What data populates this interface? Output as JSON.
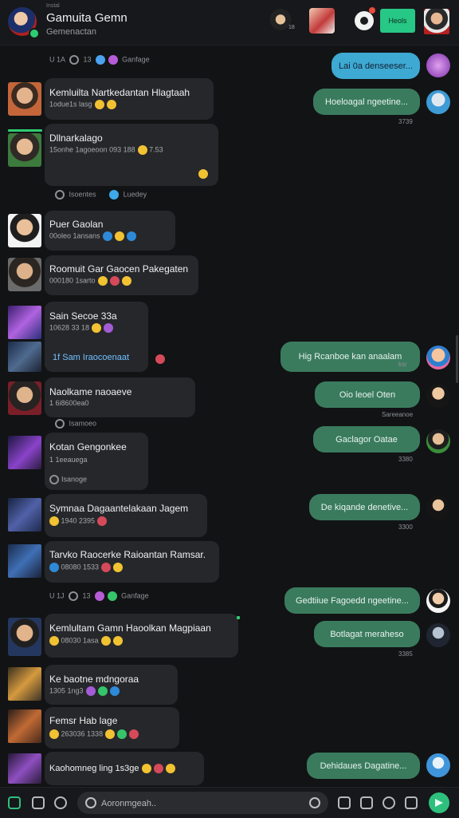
{
  "header": {
    "small_label": "Instal",
    "title": "Gamuita Gemn",
    "subtitle": "Gemenactan",
    "thumb_counts": [
      "18",
      "6"
    ],
    "join_label": "Heols"
  },
  "messages": [
    {
      "type": "system",
      "text": "Ganfage",
      "left": "U 1A",
      "num": "13"
    },
    {
      "type": "out",
      "text": "Lai 0a denseeser..."
    },
    {
      "type": "in",
      "name": "Kemluilta Nartkedantan Hlagtaah",
      "meta": "1odue1s lasg"
    },
    {
      "type": "out",
      "text": "Hoeloagal ngeetine...",
      "time": "3739"
    },
    {
      "type": "in",
      "name": "Dllnarkalago",
      "meta": "15onhe 1agoeoon 093 188",
      "extra": "7.53"
    },
    {
      "type": "system",
      "text": "Luedey",
      "left": "Isoentes"
    },
    {
      "type": "in",
      "name": "Puer Gaolan",
      "meta": "00oleo 1ansans"
    },
    {
      "type": "in",
      "name": "Roomuit Gar Gaocen Pakegaten",
      "meta": "000180 1sarto"
    },
    {
      "type": "in",
      "name": "Sain Secoe 33a",
      "meta": "10628 33 18"
    },
    {
      "type": "in",
      "name": "1f Sam Iraocoenaat",
      "meta": ""
    },
    {
      "type": "out",
      "text": "Hig Rcanboe kan anaalam",
      "time": "ksr"
    },
    {
      "type": "in",
      "name": "Naolkame naoaeve",
      "meta": "1 6i8600ea0"
    },
    {
      "type": "out",
      "text": "Oio leoel Oten",
      "time": "Sareeanoe"
    },
    {
      "type": "system",
      "text": "Isamoeo",
      "left": ""
    },
    {
      "type": "in",
      "name": "Kotan Gengonkee",
      "meta": "1 1eeauega"
    },
    {
      "type": "out",
      "text": "Gaclagor Oatae",
      "time": "3380"
    },
    {
      "type": "system",
      "text": "Isanoge",
      "left": ""
    },
    {
      "type": "in",
      "name": "Symnaa Dagaantelakaan Jagem",
      "meta": "1940 2395"
    },
    {
      "type": "out",
      "text": "De kiqande denetive...",
      "time": "3300"
    },
    {
      "type": "in",
      "name": "Tarvko Raocerke Raioantan Ramsar.",
      "meta": "08080 1533"
    },
    {
      "type": "system",
      "text": "Ganfage",
      "left": "U 1J",
      "num": "13"
    },
    {
      "type": "out",
      "text": "Gedtiiue Fagoedd ngeetine..."
    },
    {
      "type": "in",
      "name": "Kemlultam Gamn Haoolkan Magpiaan",
      "meta": "08030 1asa"
    },
    {
      "type": "out",
      "text": "Botlagat meraheso",
      "time": "3385"
    },
    {
      "type": "in",
      "name": "Ke baotne mdngoraa",
      "meta": "1305 1ng3"
    },
    {
      "type": "in",
      "name": "Femsr Hab lage",
      "meta": "263036 1338"
    },
    {
      "type": "in",
      "name": "Kaohomneg ling 1s3ge",
      "meta": ""
    },
    {
      "type": "out",
      "text": "Dehidaues Dagatine..."
    }
  ],
  "composer": {
    "placeholder": "Aoronmgeah.."
  },
  "colors": {
    "background": "#121315",
    "incoming_bubble": "#26272b",
    "outgoing_bubble": "#3a7b5e",
    "outgoing_highlight": "#3ea9d3",
    "accent_green": "#27c785"
  },
  "icons": [
    "camera-icon",
    "search-icon",
    "emoji-icon",
    "send-icon",
    "image-icon",
    "sticker-icon",
    "gif-icon",
    "game-icon"
  ]
}
